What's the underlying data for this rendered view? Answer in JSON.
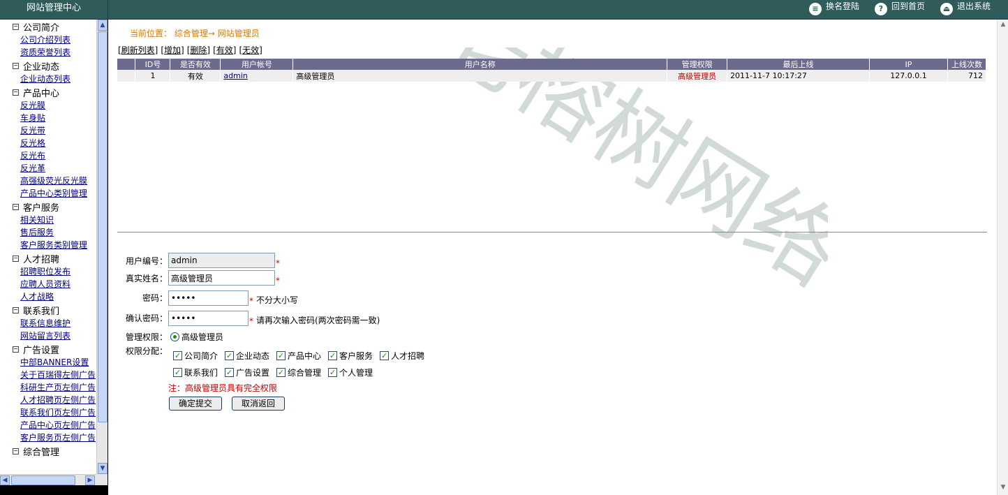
{
  "app": {
    "brand": "网站管理中心"
  },
  "topbar": {
    "actions": [
      {
        "label": "换名登陆",
        "icon": "switch-user-icon",
        "glyph": "≡"
      },
      {
        "label": "回到首页",
        "icon": "home-icon",
        "glyph": "?"
      },
      {
        "label": "退出系统",
        "icon": "logout-icon",
        "glyph": "⏏"
      }
    ]
  },
  "sidebar": {
    "groups": [
      {
        "title": "公司简介",
        "items": [
          "公司介绍列表",
          "资质荣誉列表"
        ]
      },
      {
        "title": "企业动态",
        "items": [
          "企业动态列表"
        ]
      },
      {
        "title": "产品中心",
        "items": [
          "反光膜",
          "车身贴",
          "反光带",
          "反光格",
          "反光布",
          "反光革",
          "高强级荧光反光膜",
          "产品中心类别管理"
        ]
      },
      {
        "title": "客户服务",
        "items": [
          "相关知识",
          "售后服务",
          "客户服务类别管理"
        ]
      },
      {
        "title": "人才招聘",
        "items": [
          "招聘职位发布",
          "应聘人员资料",
          "人才战略"
        ]
      },
      {
        "title": "联系我们",
        "items": [
          "联系信息维护",
          "网站留言列表"
        ]
      },
      {
        "title": "广告设置",
        "items": [
          "中部BANNER设置",
          "关于百瑞得左侧广告",
          "科研生产页左侧广告",
          "人才招聘页左侧广告",
          "联系我们页左侧广告",
          "产品中心页左侧广告",
          "客户服务页左侧广告"
        ]
      },
      {
        "title": "综合管理",
        "items": []
      }
    ]
  },
  "breadcrumb": {
    "label": "当前位置：",
    "section": "综合管理",
    "arrow": "→",
    "page": "网站管理员"
  },
  "toolbar": {
    "refresh": "[刷新列表]",
    "add": "[增加]",
    "delete": "[删除]",
    "valid": "[有效]",
    "invalid": "[无效]"
  },
  "table": {
    "headers": [
      "",
      "ID号",
      "是否有效",
      "用户帐号",
      "用户名称",
      "管理权限",
      "最后上线",
      "IP",
      "上线次数"
    ],
    "rows": [
      {
        "id": "1",
        "valid": "有效",
        "account": "admin",
        "name": "高级管理员",
        "role": "高级管理员",
        "last_login": "2011-11-7 10:17:27",
        "ip": "127.0.0.1",
        "count": "712"
      }
    ]
  },
  "form": {
    "user_id_label": "用户编号：",
    "user_id_value": "admin",
    "real_name_label": "真实姓名：",
    "real_name_value": "高级管理员",
    "password_label": "密码：",
    "password_value": "•••••",
    "password_hint": "不分大小写",
    "confirm_label": "确认密码：",
    "confirm_value": "•••••",
    "confirm_hint": "请再次输入密码(两次密码需一致)",
    "role_label": "管理权限：",
    "role_option": "高级管理员",
    "perm_label": "权限分配：",
    "permissions_row1": [
      "公司简介",
      "企业动态",
      "产品中心",
      "客户服务",
      "人才招聘"
    ],
    "permissions_row2": [
      "联系我们",
      "广告设置",
      "综合管理",
      "个人管理"
    ],
    "required_mark": "*",
    "note": "注：高级管理员具有完全权限",
    "submit": "确定提交",
    "cancel": "取消返回"
  },
  "watermark": "老榕树网络",
  "colors": {
    "topbar": "#2f5b5b",
    "table_header": "#6b6b8f",
    "link": "#000080",
    "breadcrumb": "#d47a00",
    "role_red": "#c00000"
  }
}
